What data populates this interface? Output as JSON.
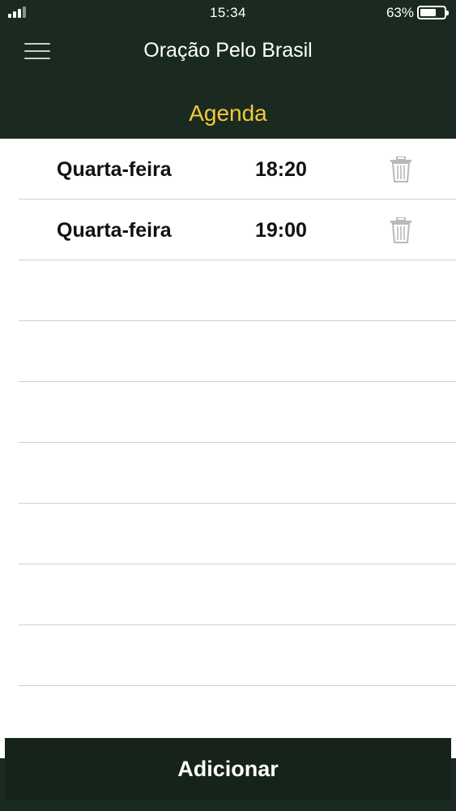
{
  "status_bar": {
    "time": "15:34",
    "battery_percent": "63%",
    "battery_level": 0.63,
    "signal_bars_active": 3,
    "signal_bars_total": 4
  },
  "header": {
    "menu_icon": "hamburger-menu-icon",
    "app_title": "Oração Pelo Brasil",
    "section_title": "Agenda"
  },
  "schedule": {
    "items": [
      {
        "day": "Quarta-feira",
        "time": "18:20",
        "action_icon": "trash-icon"
      },
      {
        "day": "Quarta-feira",
        "time": "19:00",
        "action_icon": "trash-icon"
      }
    ],
    "empty_rows": 7
  },
  "footer": {
    "add_label": "Adicionar"
  },
  "colors": {
    "header_bg": "#1b2a20",
    "section_title": "#f1c93a",
    "button_bg": "#16231a",
    "divider": "#cfcfcf"
  }
}
